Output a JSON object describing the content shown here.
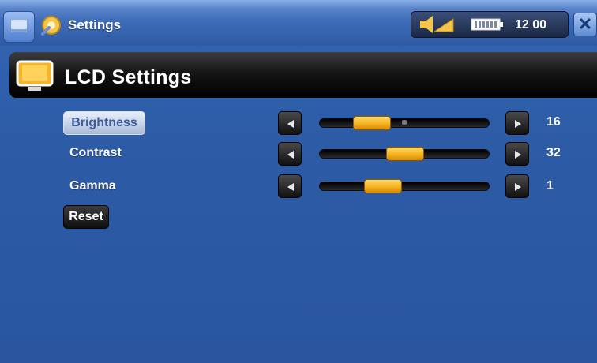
{
  "titlebar": {
    "title": "Settings",
    "clock": "12 00",
    "close_label": "✕"
  },
  "header": {
    "title": "LCD Settings"
  },
  "settings": [
    {
      "label": "Brightness",
      "value": "16",
      "level": 0.25,
      "selected": true
    },
    {
      "label": "Contrast",
      "value": "32",
      "level": 0.5,
      "selected": false
    },
    {
      "label": "Gamma",
      "value": "1",
      "level": 0.3,
      "selected": false
    }
  ],
  "reset_label": "Reset",
  "icons": {
    "home": "home-icon",
    "settings": "settings-satellite-icon",
    "sound": "speaker-icon",
    "battery": "battery-icon",
    "close": "close-icon",
    "lcd": "monitor-icon",
    "left": "arrow-left-icon",
    "right": "arrow-right-icon"
  },
  "colors": {
    "background": "#2a56a0",
    "knob": "#f4b21f",
    "header_band": "#000000"
  }
}
